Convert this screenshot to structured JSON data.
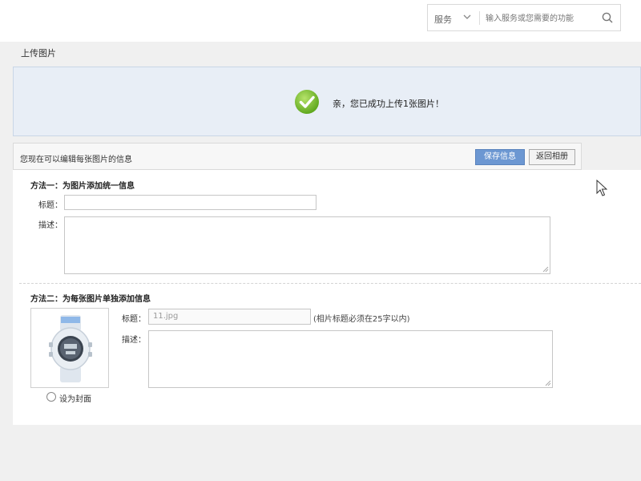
{
  "topbar": {
    "service_select": "服务",
    "search_placeholder": "输入服务或您需要的功能"
  },
  "upload": {
    "title": "上传图片",
    "success_message": "亲，您已成功上传1张图片！"
  },
  "edit_bar": {
    "tip": "您现在可以编辑每张图片的信息",
    "save_label": "保存信息",
    "back_label": "返回相册"
  },
  "method1": {
    "title": "方法一：为图片添加统一信息",
    "title_label": "标题：",
    "desc_label": "描述：",
    "title_value": "",
    "desc_value": ""
  },
  "method2": {
    "title": "方法二：为每张图片单独添加信息",
    "title_label": "标题：",
    "title_value": "11.jpg",
    "title_hint": "(相片标题必须在25字以内)",
    "desc_label": "描述：",
    "desc_value": "",
    "cover_label": "设为封面",
    "thumbnail": "watch-image"
  },
  "colors": {
    "success_bg": "#e8eef6",
    "primary_button": "#6c97d2",
    "ok_green": "#7cc33a"
  }
}
